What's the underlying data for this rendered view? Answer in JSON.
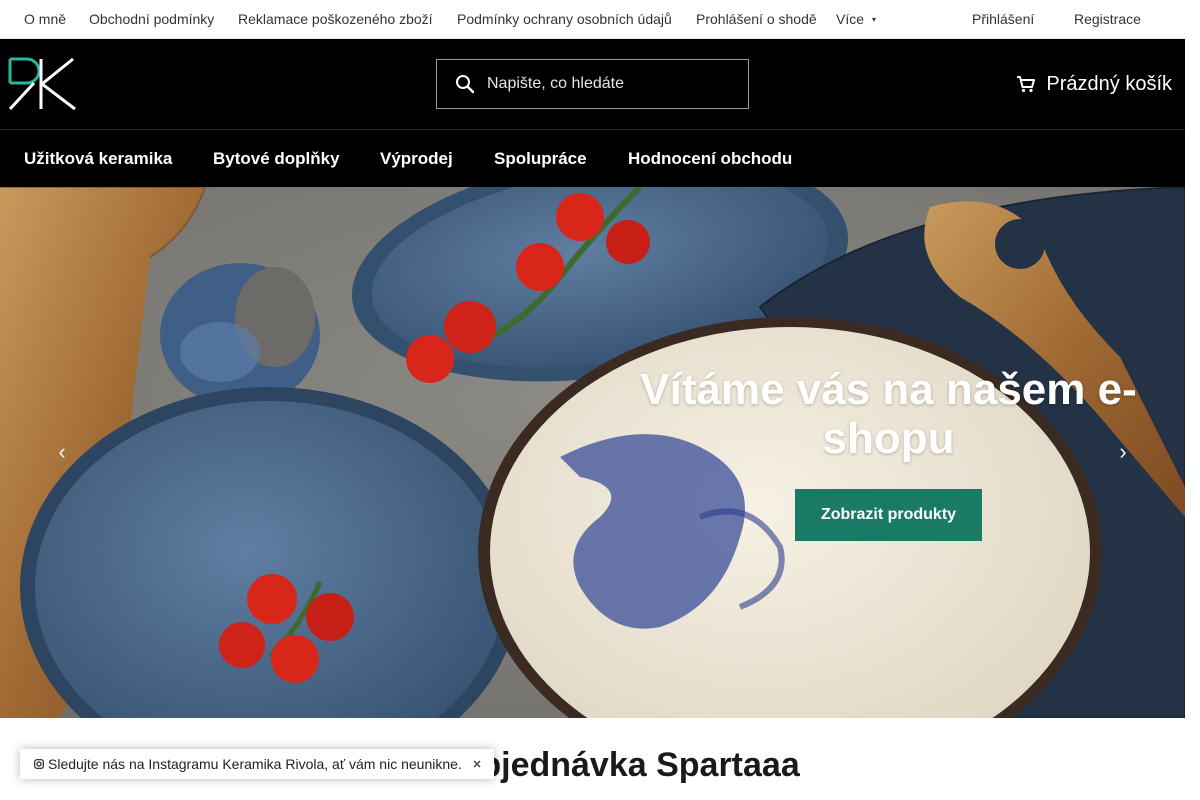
{
  "topbar": {
    "links": [
      "O mně",
      "Obchodní podmínky",
      "Reklamace poškozeného zboží",
      "Podmínky ochrany osobních údajů",
      "Prohlášení o shodě"
    ],
    "more_label": "Více",
    "more_icon": "chevron-down-icon",
    "login_label": "Přihlášení",
    "register_label": "Registrace"
  },
  "header": {
    "logo_icon": "rk-monogram-logo",
    "search_placeholder": "Napište, co hledáte",
    "search_value": "",
    "search_icon": "search-icon",
    "cart_icon": "cart-icon",
    "cart_label": "Prázdný košík"
  },
  "nav": {
    "items": [
      "Užitková keramika",
      "Bytové doplňky",
      "Výprodej",
      "Spolupráce",
      "Hodnocení obchodu"
    ]
  },
  "hero": {
    "title": "Vítáme vás na našem e-shopu",
    "cta_label": "Zobrazit produkty",
    "prev_icon": "chevron-left-icon",
    "next_icon": "chevron-right-icon"
  },
  "section": {
    "title": "Předobjednávka Spartaaa"
  },
  "toast": {
    "icon": "instagram-icon",
    "text": "Sledujte nás na Instagramu Keramika Rivola, ať vám nic neunikne.",
    "close_icon": "close-icon"
  },
  "colors": {
    "brand_teal": "#1b7a66",
    "header_black": "#000000",
    "logo_teal": "#2bb5a1"
  }
}
